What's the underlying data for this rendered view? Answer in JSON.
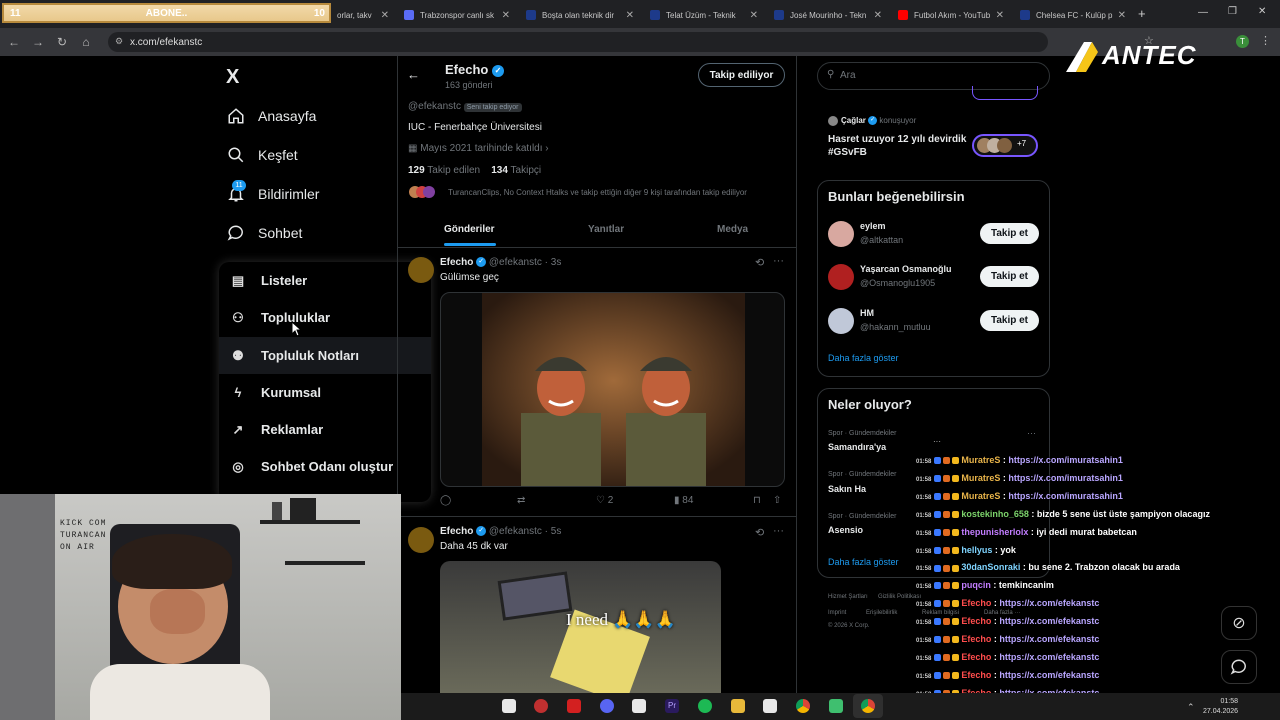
{
  "abone": {
    "left": "11",
    "label": "ABONE..",
    "right": "10"
  },
  "tabs": [
    {
      "label": "orlar, takv",
      "color": "#cccccc"
    },
    {
      "label": "Trabzonspor canlı sk",
      "color": "#5a6cf5"
    },
    {
      "label": "Boşta olan teknik dir",
      "color": "#1d3a8a"
    },
    {
      "label": "Telat Üzüm - Teknik",
      "color": "#1d3a8a"
    },
    {
      "label": "José Mourinho - Tekn",
      "color": "#1d3a8a"
    },
    {
      "label": "Futbol Akım - YouTub",
      "color": "#ff0000"
    },
    {
      "label": "Chelsea FC - Kulüp p",
      "color": "#1d3a8a"
    }
  ],
  "browser": {
    "url": "x.com/efekanstc",
    "new_tab": "+",
    "profile_letter": "T"
  },
  "antec_logo": "ANTEC",
  "sidebar": {
    "logo": "X",
    "items": [
      {
        "label": "Anasayfa",
        "icon": "home-icon"
      },
      {
        "label": "Keşfet",
        "icon": "search-icon"
      },
      {
        "label": "Bildirimler",
        "icon": "bell-icon",
        "badge": "11"
      },
      {
        "label": "Sohbet",
        "icon": "chat-icon"
      }
    ]
  },
  "more_menu": {
    "items": [
      {
        "label": "Listeler",
        "icon": "list-icon"
      },
      {
        "label": "Topluluklar",
        "icon": "communities-icon"
      },
      {
        "label": "Topluluk Notları",
        "icon": "community-notes-icon"
      },
      {
        "label": "Kurumsal",
        "icon": "lightning-icon"
      },
      {
        "label": "Reklamlar",
        "icon": "ads-icon"
      },
      {
        "label": "Sohbet Odanı oluştur",
        "icon": "spaces-icon"
      }
    ]
  },
  "profile": {
    "header_name": "Efecho",
    "header_posts": "163 gönderi",
    "follow_button": "Takip ediliyor",
    "behind_name": "Efecho",
    "handle": "@efekanstc",
    "follows_you": "Seni takip ediyor",
    "bio": "IUC - Fenerbahçe Üniversitesi",
    "joined": "Mayıs 2021 tarihinde katıldı",
    "following_count": "129",
    "following_label": "Takip edilen",
    "followers_count": "134",
    "followers_label": "Takipçi",
    "mutuals": "TurancanClips, No Context Htalks ve takip ettiğin diğer 9 kişi tarafından takip ediliyor"
  },
  "profile_tabs": [
    "Gönderiler",
    "Yanıtlar",
    "Medya"
  ],
  "posts": [
    {
      "name": "Efecho",
      "handle": "@efekanstc",
      "time": "3s",
      "text": "Gülümse geç",
      "replies": "",
      "reposts": "",
      "likes": "2",
      "views": "84"
    },
    {
      "name": "Efecho",
      "handle": "@efekanstc",
      "time": "5s",
      "text": "Daha 45 dk var",
      "image_caption": "I need 🙏🙏🙏"
    }
  ],
  "right": {
    "search_placeholder": "Ara",
    "space_host": "Çağlar",
    "space_status": "konuşuyor",
    "space_title": "Hasret uzuyor 12 yılı devirdik #GSvFB",
    "space_more": "+7",
    "suggest_title": "Bunları beğenebilirsin",
    "suggestions": [
      {
        "name": "eylem",
        "handle": "@altkattan",
        "button": "Takip et"
      },
      {
        "name": "Yaşarcan Osmanoğlu",
        "handle": "@Osmanoglu1905",
        "button": "Takip et"
      },
      {
        "name": "HM",
        "handle": "@hakann_mutluu",
        "button": "Takip et"
      }
    ],
    "suggest_more": "Daha fazla göster",
    "trends_title": "Neler oluyor?",
    "trends": [
      {
        "category": "Spor · Gündemdekiler",
        "name": "Samandıra'ya"
      },
      {
        "category": "Spor · Gündemdekiler",
        "name": "Sakın Ha"
      },
      {
        "category": "Spor · Gündemdekiler",
        "name": "Asensio"
      }
    ],
    "trends_more": "Daha fazla göster",
    "footer1": "Hizmet Şartları",
    "footer2": "Gizlilik Politikası",
    "footer3": "Imprint",
    "footer4": "Erişilebilirlik",
    "footer5": "Reklam bilgisi",
    "footer6": "Daha fazla ···",
    "copyright": "© 2026 X Corp."
  },
  "webcam_sign": [
    "KICK COM",
    "TURANCAN",
    "ON AIR"
  ],
  "chat": [
    {
      "user": "MuratreS",
      "color": "#e8b44a",
      "msg": "https://x.com/imuratsahin1",
      "link": true
    },
    {
      "user": "MuratreS",
      "color": "#e8b44a",
      "msg": "https://x.com/imuratsahin1",
      "link": true
    },
    {
      "user": "MuratreS",
      "color": "#e8b44a",
      "msg": "https://x.com/imuratsahin1",
      "link": true
    },
    {
      "user": "kostekinho_658",
      "color": "#7cd36b",
      "msg": "bizde 5 sene üst üste şampiyon olacagız",
      "link": false
    },
    {
      "user": "thepunisherlolx",
      "color": "#c27dff",
      "msg": "iyi dedi murat babetcan",
      "link": false
    },
    {
      "user": "hellyus",
      "color": "#7fd4ff",
      "msg": "yok",
      "link": false
    },
    {
      "user": "30danSonraki",
      "color": "#7fd4ff",
      "msg": "bu sene 2. Trabzon olacak bu arada",
      "link": false
    },
    {
      "user": "puqcin",
      "color": "#c27dff",
      "msg": "temkincanim",
      "link": false
    },
    {
      "user": "Efecho",
      "color": "#ff4d4d",
      "msg": "https://x.com/efekanstc",
      "link": true
    },
    {
      "user": "Efecho",
      "color": "#ff4d4d",
      "msg": "https://x.com/efekanstc",
      "link": true
    },
    {
      "user": "Efecho",
      "color": "#ff4d4d",
      "msg": "https://x.com/efekanstc",
      "link": true
    },
    {
      "user": "Efecho",
      "color": "#ff4d4d",
      "msg": "https://x.com/efekanstc",
      "link": true
    },
    {
      "user": "Efecho",
      "color": "#ff4d4d",
      "msg": "https://x.com/efekanstc",
      "link": true
    },
    {
      "user": "Efecho",
      "color": "#ff4d4d",
      "msg": "https://x.com/efekanstc",
      "link": true
    },
    {
      "user": "Efecho",
      "color": "#ff4d4d",
      "msg": "https://x.com/efekanstc",
      "link": true
    }
  ],
  "chat_time": "01:58",
  "taskbar": {
    "time": "01:58",
    "date": "27.04.2026"
  }
}
